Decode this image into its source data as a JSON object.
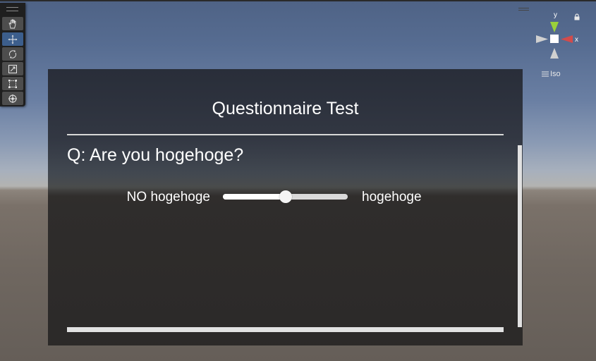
{
  "toolbar": {
    "tools": [
      {
        "icon": "hand-icon",
        "active": false
      },
      {
        "icon": "move-icon",
        "active": true
      },
      {
        "icon": "rotate-icon",
        "active": false
      },
      {
        "icon": "scale-icon",
        "active": false
      },
      {
        "icon": "rect-tool-icon",
        "active": false
      },
      {
        "icon": "transform-icon",
        "active": false
      }
    ]
  },
  "gizmo": {
    "y_label": "y",
    "x_label": "x",
    "projection": "Iso",
    "colors": {
      "y": "#9ad13a",
      "x": "#d24b4b",
      "neutral": "#d0d0d0"
    }
  },
  "panel": {
    "title": "Questionnaire Test",
    "question": "Q: Are you hogehoge?",
    "slider": {
      "left_label": "NO hogehoge",
      "right_label": "hogehoge",
      "value": 0.5
    }
  }
}
